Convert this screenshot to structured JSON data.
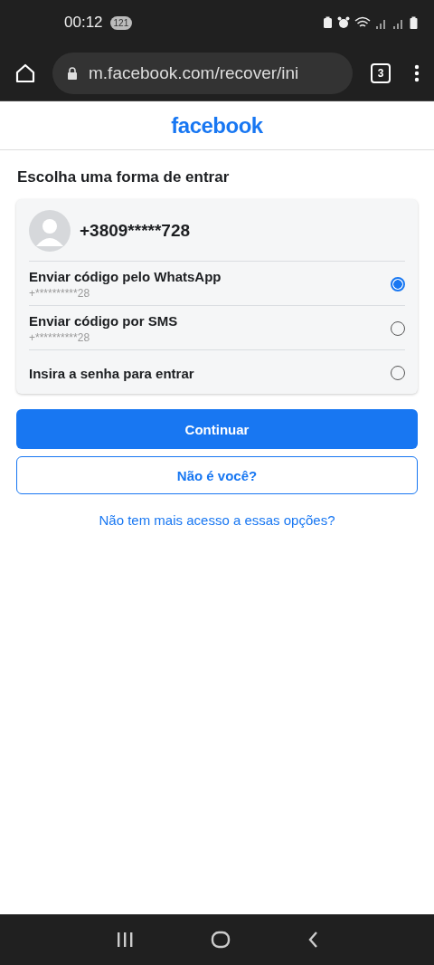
{
  "status_bar": {
    "time": "00:12",
    "notification_count": "121"
  },
  "browser": {
    "url": "m.facebook.com/recover/ini",
    "tab_count": "3"
  },
  "header": {
    "logo": "facebook"
  },
  "title": "Escolha uma forma de entrar",
  "account": {
    "phone": "+3809*****728"
  },
  "options": [
    {
      "label": "Enviar código pelo WhatsApp",
      "detail": "+**********28",
      "selected": true
    },
    {
      "label": "Enviar código por SMS",
      "detail": "+**********28",
      "selected": false
    },
    {
      "label": "Insira a senha para entrar",
      "selected": false
    }
  ],
  "continue_button": "Continuar",
  "not_you_button": "Não é você?",
  "no_access_link": "Não tem mais acesso a essas opções?"
}
